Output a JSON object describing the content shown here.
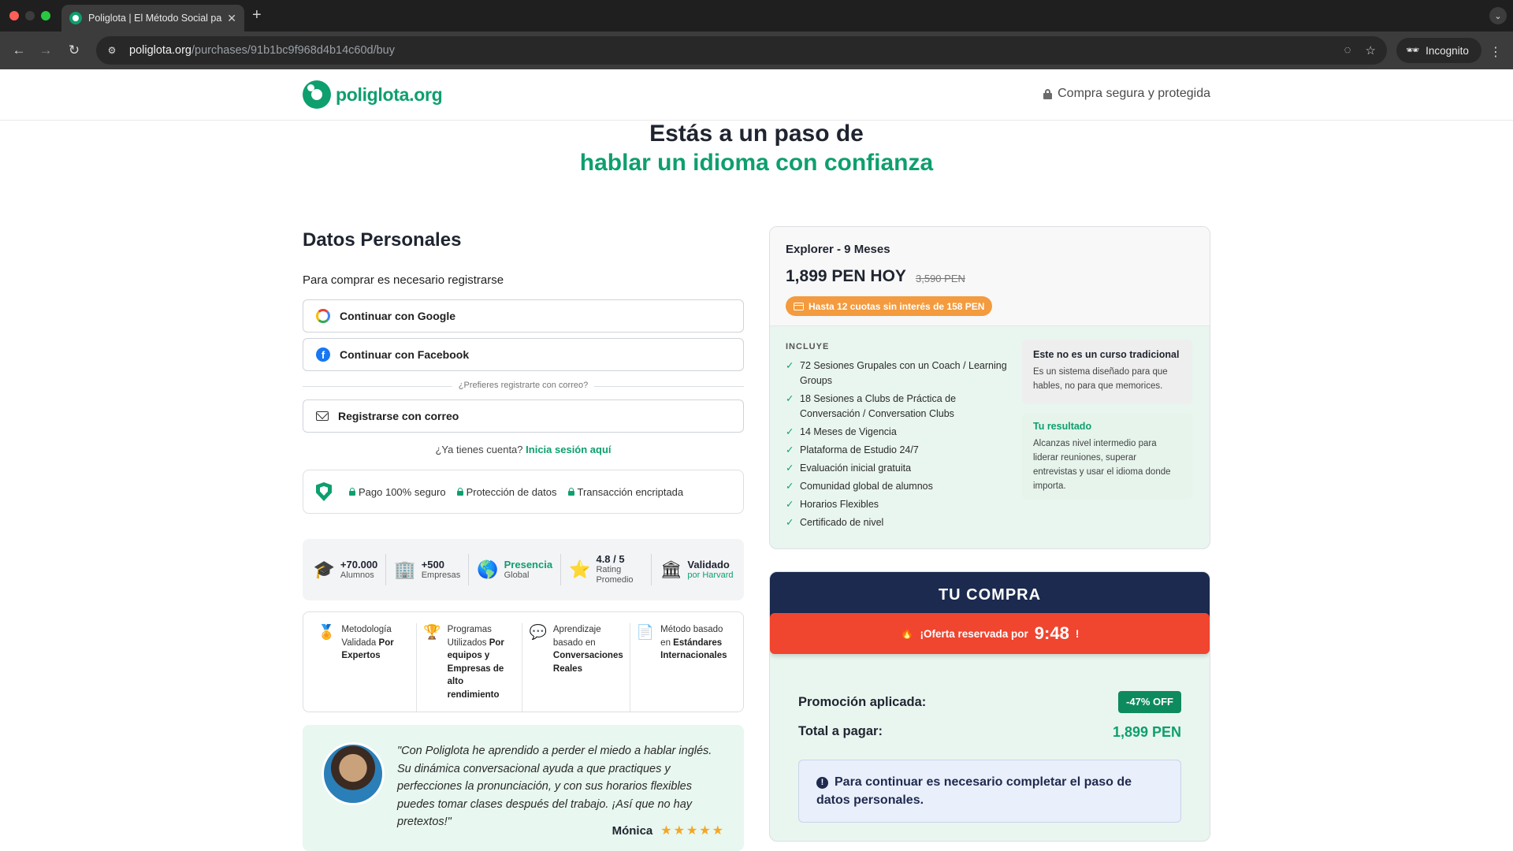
{
  "browser": {
    "tab_title": "Poliglota | El Método Social para",
    "url_host": "poliglota.org",
    "url_path": "/purchases/91b1bc9f968d4b14c60d/buy",
    "incognito_label": "Incognito"
  },
  "header": {
    "logo_text": "poliglota.org",
    "secure_text": "Compra segura y protegida"
  },
  "hero": {
    "line1": "Estás a un paso de",
    "line2": "hablar un idioma con confianza"
  },
  "form": {
    "title": "Datos Personales",
    "register_note": "Para comprar es necesario registrarse",
    "google_label": "Continuar con Google",
    "facebook_label": "Continuar con Facebook",
    "divider_text": "¿Prefieres registrarte con correo?",
    "email_label": "Registrarse con correo",
    "has_account_text": "¿Ya tienes cuenta?",
    "login_link": "Inicia sesión aquí"
  },
  "trust": {
    "items": [
      "Pago 100% seguro",
      "Protección de datos",
      "Transacción encriptada"
    ]
  },
  "stats": [
    {
      "icon": "🎓",
      "main": "+70.000",
      "sub": "Alumnos",
      "green": false
    },
    {
      "icon": "🏢",
      "main": "+500",
      "sub": "Empresas",
      "green": false
    },
    {
      "icon": "🌎",
      "main": "Presencia",
      "sub": "Global",
      "green": true
    },
    {
      "icon": "⭐",
      "main": "4.8 / 5",
      "sub": "Rating Promedio",
      "green": false
    },
    {
      "icon": "🏛",
      "main": "Validado",
      "sub": "por Harvard",
      "green": true
    }
  ],
  "features": [
    {
      "icon": "🏅",
      "text": "Metodología Validada",
      "bold": "Por Expertos"
    },
    {
      "icon": "🏆",
      "text": "Programas Utilizados",
      "bold": "Por equipos y Empresas de alto rendimiento"
    },
    {
      "icon": "💬",
      "text": "Aprendizaje basado en",
      "bold": "Conversaciones Reales"
    },
    {
      "icon": "📄",
      "text": "Método basado en",
      "bold": "Estándares Internacionales"
    }
  ],
  "testimonial": {
    "quote": "\"Con Poliglota he aprendido a perder el miedo a hablar inglés. Su dinámica conversacional ayuda a que practiques y perfecciones la pronunciación, y con sus horarios flexibles puedes tomar clases después del trabajo. ¡Así que no hay pretextos!\"",
    "author": "Mónica",
    "stars": "★★★★★"
  },
  "plan": {
    "name": "Explorer - 9 Meses",
    "price": "1,899 PEN HOY",
    "old_price": "3,590 PEN",
    "installments_badge": "Hasta 12 cuotas sin interés de 158 PEN",
    "includes_title": "INCLUYE",
    "includes": [
      "72 Sesiones Grupales con un Coach / Learning Groups",
      "18 Sesiones a Clubs de Práctica de Conversación / Conversation Clubs",
      "14 Meses de Vigencia",
      "Plataforma de Estudio 24/7",
      "Evaluación inicial gratuita",
      "Comunidad global de alumnos",
      "Horarios Flexibles",
      "Certificado de nivel"
    ],
    "box1_title": "Este no es un curso tradicional",
    "box1_body": "Es un sistema diseñado para que hables, no para que memorices.",
    "box2_title": "Tu resultado",
    "box2_body": "Alcanzas nivel intermedio para liderar reuniones, superar entrevistas y usar el idioma donde importa."
  },
  "purchase": {
    "title": "TU COMPRA",
    "offer_text": "¡Oferta reservada por",
    "offer_timer": "9:48",
    "offer_end": "!",
    "promo_label": "Promoción aplicada:",
    "promo_badge": "-47% OFF",
    "total_label": "Total a pagar:",
    "total_value": "1,899 PEN",
    "info_text": "Para continuar es necesario completar el paso de datos personales."
  },
  "colors": {
    "brand_green": "#0e9f6e",
    "navy": "#1b2a4e",
    "offer_red": "#f0452f",
    "badge_orange": "#f39b3e"
  }
}
